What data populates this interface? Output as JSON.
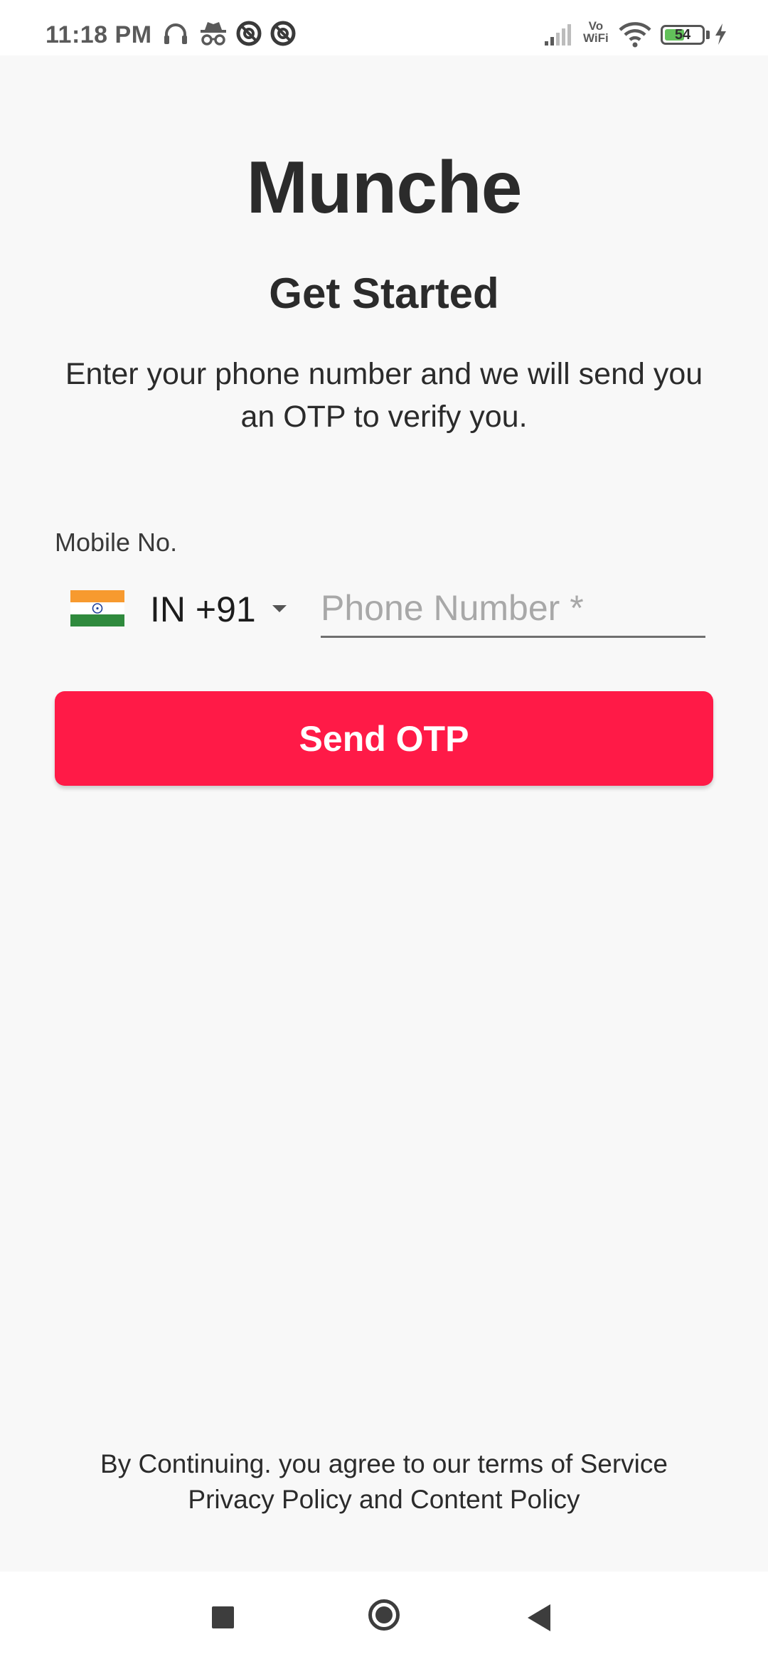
{
  "status_bar": {
    "time": "11:18 PM",
    "left_icons": [
      "headphones-icon",
      "incognito-icon",
      "blocked-app-icon",
      "blocked-app-icon"
    ],
    "vowifi_line1": "Vo",
    "vowifi_line2": "WiFi",
    "battery_level": "54",
    "battery_fraction": 0.54,
    "right_icons": [
      "signal-icon",
      "vowifi-icon",
      "wifi-icon",
      "battery-icon",
      "charging-icon"
    ]
  },
  "app": {
    "title": "Munche",
    "heading": "Get Started",
    "subtitle": "Enter your phone number and we will send you an OTP to verify you."
  },
  "form": {
    "mobile_label": "Mobile No.",
    "country_code": "IN  +91",
    "phone_value": "",
    "phone_placeholder": "Phone Number *",
    "send_label": "Send OTP"
  },
  "footer": {
    "terms_line1": "By Continuing. you agree to our terms of Service",
    "terms_line2": "Privacy Policy and Content Policy"
  },
  "nav_bar": {
    "buttons": [
      "recents-button",
      "home-button",
      "back-button"
    ]
  },
  "colors": {
    "accent": "#ff1a47",
    "background": "#f8f8f8",
    "text": "#2b2b2b",
    "flag_saffron": "#f79a2f",
    "flag_green": "#2f8a3d",
    "flag_chakra": "#1f3f96"
  }
}
